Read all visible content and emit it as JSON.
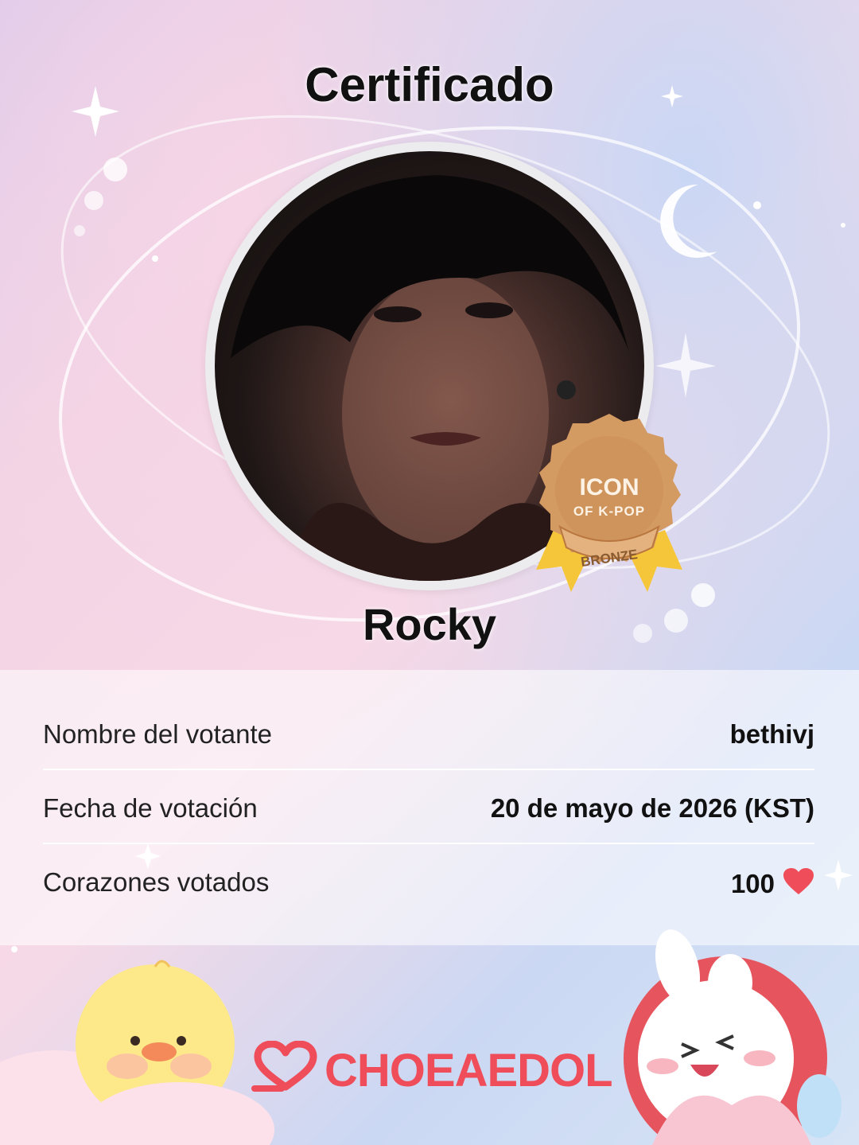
{
  "certificate": {
    "title": "Certificado",
    "artist_name": "Rocky"
  },
  "badge": {
    "title_line1": "ICON",
    "title_line2": "OF K-POP",
    "tier": "BRONZE",
    "colors": {
      "medal": "#d39a62",
      "ribbon": "#f6c63a"
    }
  },
  "details": [
    {
      "label": "Nombre del votante",
      "value": "bethivj"
    },
    {
      "label": "Fecha de votación",
      "value": "20 de mayo de 2026 (KST)"
    },
    {
      "label": "Corazones votados",
      "value": "100",
      "icon": "heart-icon"
    }
  ],
  "brand": {
    "name": "CHOEAEDOL",
    "color": "#ee4d59"
  }
}
